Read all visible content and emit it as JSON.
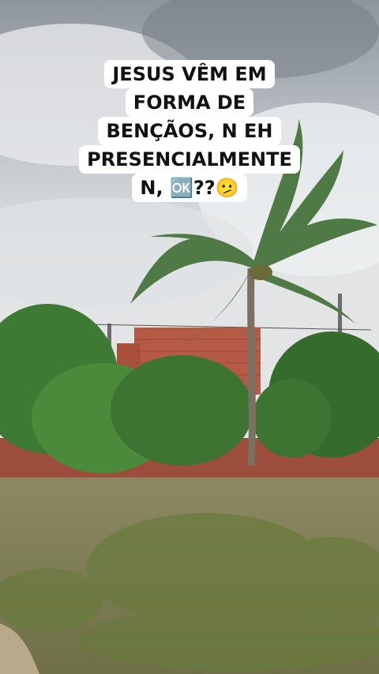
{
  "caption": {
    "lines": [
      "JESUS VÊM EM",
      "FORMA DE",
      "BENÇÃOS, N EH",
      "PRESENCIALMENTE",
      "N, 🆗??🫤"
    ]
  },
  "scene": {
    "description_icons": [
      "palm-tree",
      "bushes",
      "brick-wall",
      "utility-pole"
    ],
    "colors": {
      "sky": "#c9ced3",
      "bricks": "#b55a44",
      "foliage": "#3f7a34",
      "ground": "#8b8a63"
    }
  }
}
